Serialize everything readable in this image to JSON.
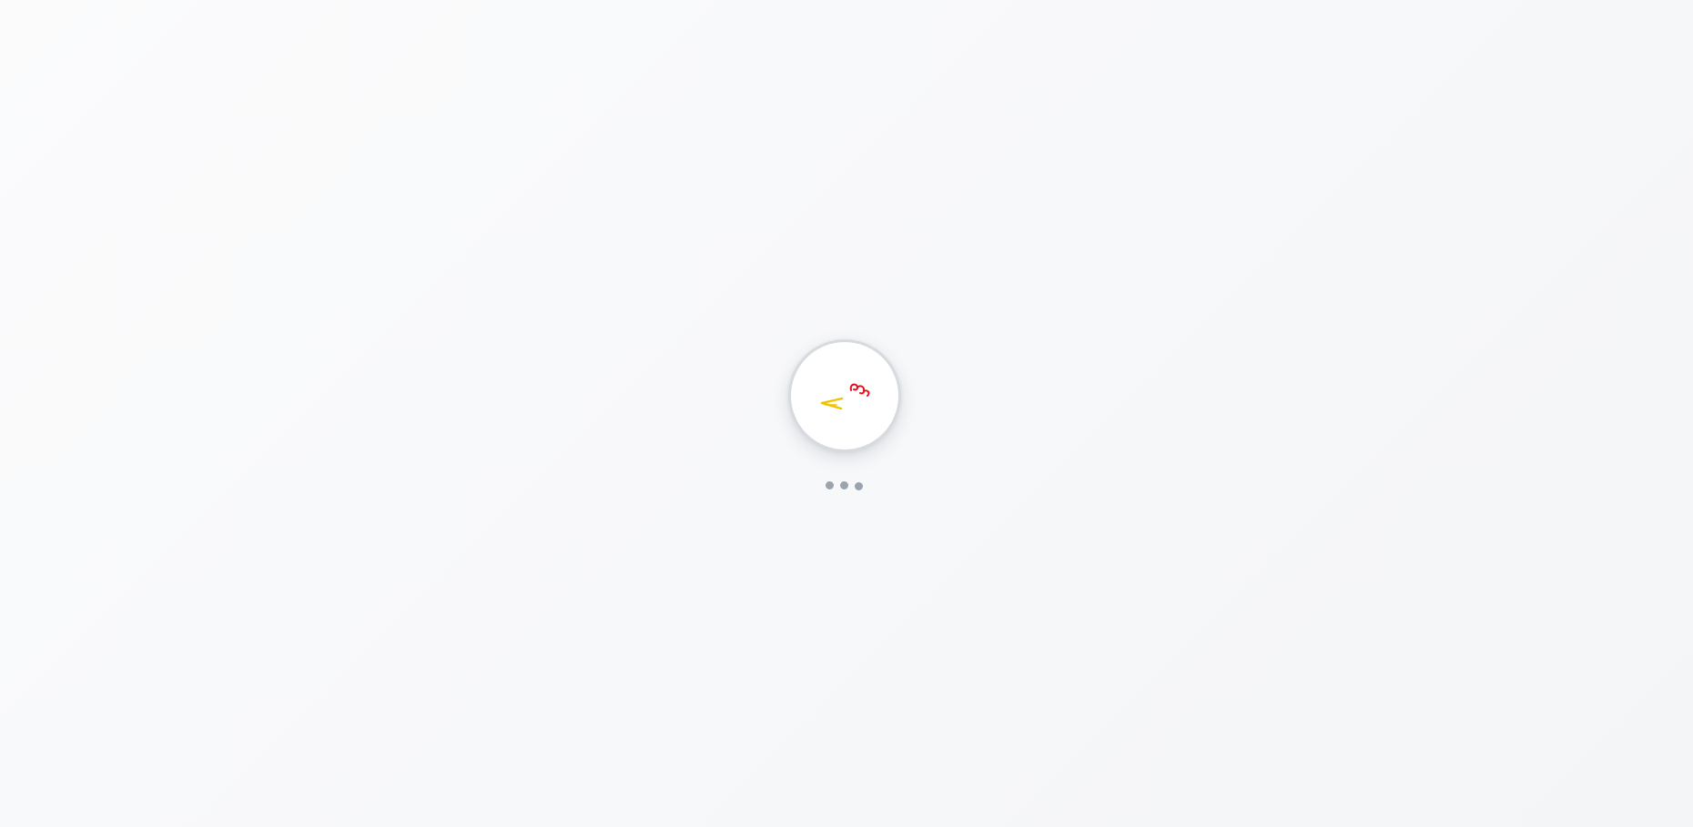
{
  "loader": {
    "logo_icon": "brand-logo-icon",
    "logo_colors": {
      "accent_yellow": "#f2c200",
      "accent_red": "#e3101e"
    },
    "indicator_icon": "loading-dots-icon",
    "dot_count": 3,
    "dot_color": "#9aa3ae"
  }
}
